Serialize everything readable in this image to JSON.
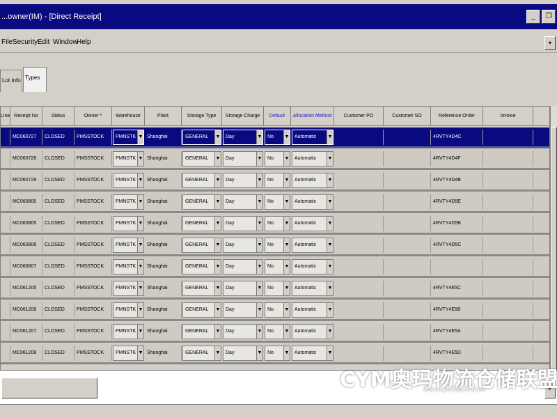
{
  "window": {
    "title": "...owner(IM) - [Direct Receipt]",
    "minimize_glyph": "_",
    "restore_glyph": "❐"
  },
  "menu": {
    "items": [
      "File",
      "Security",
      "Edit",
      "Window",
      "Help"
    ],
    "right_glyph": "▾"
  },
  "tabs": [
    {
      "label": "Lot Info"
    },
    {
      "label": "Types"
    }
  ],
  "grid": {
    "columns": [
      {
        "label": "Line",
        "highlight": false
      },
      {
        "label": "Receipt No",
        "highlight": false
      },
      {
        "label": "Status",
        "highlight": false
      },
      {
        "label": "Owner *",
        "highlight": false
      },
      {
        "label": "Warehouse",
        "highlight": false
      },
      {
        "label": "Plant",
        "highlight": false
      },
      {
        "label": "Storage Type",
        "highlight": false
      },
      {
        "label": "Storage Charge",
        "highlight": false
      },
      {
        "label": "Default",
        "highlight": true
      },
      {
        "label": "Allocation Method",
        "highlight": true
      },
      {
        "label": "Customer PO",
        "highlight": false
      },
      {
        "label": "Customer SO",
        "highlight": false
      },
      {
        "label": "Reference Order",
        "highlight": false
      },
      {
        "label": "Invoice",
        "highlight": false
      }
    ],
    "rows": [
      {
        "receipt": "MC060727",
        "status": "CLOSED",
        "owner": "PMSSTOCK",
        "warehouse": "PMNSTK",
        "plant": "Shanghai",
        "storage_type": "GENERAL",
        "charge": "Day",
        "default": "No",
        "alloc": "Automatic",
        "reference": "4RVTY4D4C",
        "selected": true
      },
      {
        "receipt": "MC060728",
        "status": "CLOSED",
        "owner": "PMSSTOCK",
        "warehouse": "PMNSTK",
        "plant": "Shanghai",
        "storage_type": "GENERAL",
        "charge": "Day",
        "default": "No",
        "alloc": "Automatic",
        "reference": "4RVTY4D4F",
        "selected": false
      },
      {
        "receipt": "MC060729",
        "status": "CLOSED",
        "owner": "PMSSTOCK",
        "warehouse": "PMNSTK",
        "plant": "Shanghai",
        "storage_type": "GENERAL",
        "charge": "Day",
        "default": "No",
        "alloc": "Automatic",
        "reference": "4RVTY4D4B",
        "selected": false
      },
      {
        "receipt": "MC060800",
        "status": "CLOSED",
        "owner": "PMSSTOCK",
        "warehouse": "PMNSTK",
        "plant": "Shanghai",
        "storage_type": "GENERAL",
        "charge": "Day",
        "default": "No",
        "alloc": "Automatic",
        "reference": "4RVTY4D5E",
        "selected": false
      },
      {
        "receipt": "MC060805",
        "status": "CLOSED",
        "owner": "PMSSTOCK",
        "warehouse": "PMNSTK",
        "plant": "Shanghai",
        "storage_type": "GENERAL",
        "charge": "Day",
        "default": "No",
        "alloc": "Automatic",
        "reference": "4RVTY4D5B",
        "selected": false
      },
      {
        "receipt": "MC060806",
        "status": "CLOSED",
        "owner": "PMSSTOCK",
        "warehouse": "PMNSTK",
        "plant": "Shanghai",
        "storage_type": "GENERAL",
        "charge": "Day",
        "default": "No",
        "alloc": "Automatic",
        "reference": "4RVTY4D5C",
        "selected": false
      },
      {
        "receipt": "MC060807",
        "status": "CLOSED",
        "owner": "PMSSTOCK",
        "warehouse": "PMNSTK",
        "plant": "Shanghai",
        "storage_type": "GENERAL",
        "charge": "Day",
        "default": "No",
        "alloc": "Automatic",
        "reference": "",
        "selected": false
      },
      {
        "receipt": "MC061205",
        "status": "CLOSED",
        "owner": "PMSSTOCK",
        "warehouse": "PMNSTK",
        "plant": "Shanghai",
        "storage_type": "GENERAL",
        "charge": "Day",
        "default": "No",
        "alloc": "Automatic",
        "reference": "4RVTY4E5C",
        "selected": false
      },
      {
        "receipt": "MC061206",
        "status": "CLOSED",
        "owner": "PMSSTOCK",
        "warehouse": "PMNSTK",
        "plant": "Shanghai",
        "storage_type": "GENERAL",
        "charge": "Day",
        "default": "No",
        "alloc": "Automatic",
        "reference": "4RVTY4E5B",
        "selected": false
      },
      {
        "receipt": "MC061207",
        "status": "CLOSED",
        "owner": "PMSSTOCK",
        "warehouse": "PMNSTK",
        "plant": "Shanghai",
        "storage_type": "GENERAL",
        "charge": "Day",
        "default": "No",
        "alloc": "Automatic",
        "reference": "4RVTY4E5A",
        "selected": false
      },
      {
        "receipt": "MC061208",
        "status": "CLOSED",
        "owner": "PMSSTOCK",
        "warehouse": "PMNSTK",
        "plant": "Shanghai",
        "storage_type": "GENERAL",
        "charge": "Day",
        "default": "No",
        "alloc": "Automatic",
        "reference": "4RVTY4E5D",
        "selected": false
      }
    ],
    "combo_arrow": "▼"
  },
  "scroll": {
    "right_glyph": "▸"
  },
  "watermark": {
    "main": "CYM奥玛物流仓储联盟",
    "sub": "www.cym56Lm.com"
  },
  "colors": {
    "titlebar": "#0a0a80",
    "selected_row": "#0a0a80",
    "face": "#d4d0c8",
    "header_highlight": "#1a1ad0"
  }
}
